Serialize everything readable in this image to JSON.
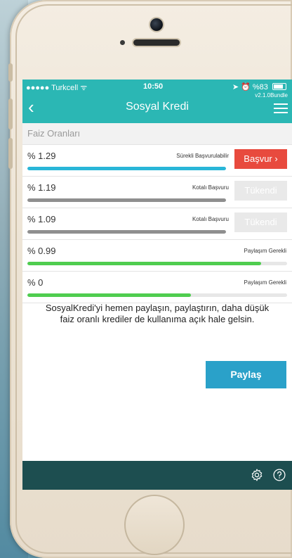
{
  "status_bar": {
    "carrier": "●●●●● Turkcell ᯤ",
    "time": "10:50",
    "battery": "%83"
  },
  "nav": {
    "title": "Sosyal Kredi",
    "version": "v2.1.0Bundle",
    "back_icon": "chevron-left-icon",
    "menu_icon": "hamburger-icon"
  },
  "section_header": "Faiz Oranları",
  "rates": [
    {
      "rate": "% 1.29",
      "status": "Sürekli Başvurulabilir",
      "progress": 1.0,
      "bar_color": "#29b6d8",
      "button": "Başvur ›",
      "button_state": "active"
    },
    {
      "rate": "% 1.19",
      "status": "Kotalı Başvuru",
      "progress": 1.0,
      "bar_color": "#8f8f8f",
      "button": "Tükendi",
      "button_state": "disabled"
    },
    {
      "rate": "% 1.09",
      "status": "Kotalı Başvuru",
      "progress": 1.0,
      "bar_color": "#8f8f8f",
      "button": "Tükendi",
      "button_state": "disabled"
    },
    {
      "rate": "% 0.99",
      "status": "Paylaşım Gerekli",
      "progress": 0.9,
      "bar_color": "#4fcd4f",
      "button": "",
      "button_state": "none"
    },
    {
      "rate": "% 0",
      "status": "Paylaşım Gerekli",
      "progress": 0.63,
      "bar_color": "#4fcd4f",
      "button": "",
      "button_state": "none"
    }
  ],
  "message": "SosyalKredi'yi hemen paylaşın, paylaştırın, daha düşük faiz oranlı krediler de kullanıma açık hale gelsin.",
  "share_button": "Paylaş",
  "footer": {
    "settings_icon": "gear-icon",
    "help_icon": "help-icon"
  },
  "colors": {
    "header": "#2bb7b4",
    "footer": "#1d4e50",
    "apply_button": "#e84a3e",
    "share_button": "#2aa1c9"
  }
}
